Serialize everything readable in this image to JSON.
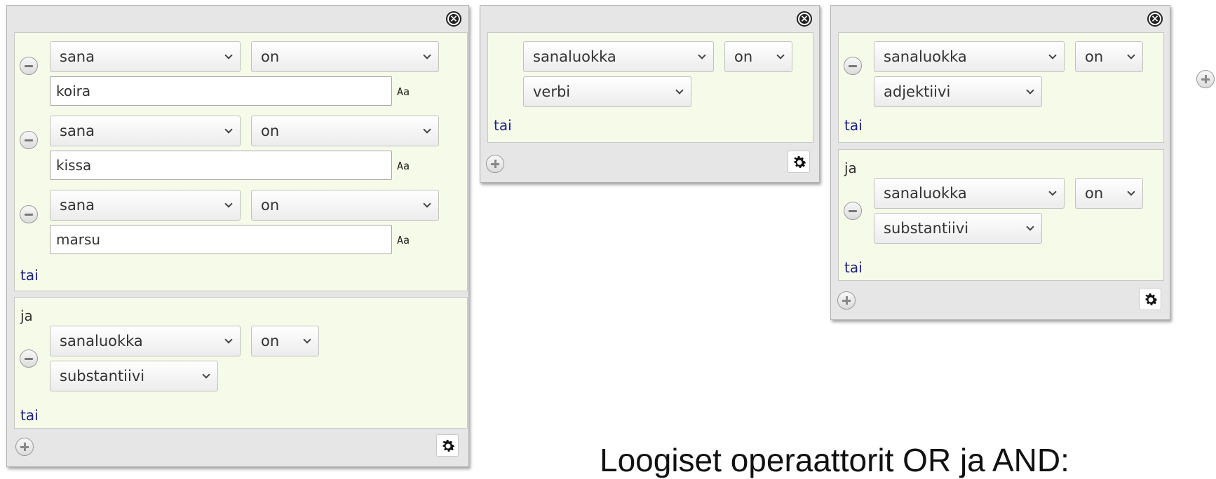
{
  "tokens": [
    {
      "blocks": [
        {
          "rows": [
            {
              "field": "sana",
              "operator": "on",
              "value": "koira",
              "case_toggle": "Aa"
            },
            {
              "field": "sana",
              "operator": "on",
              "value": "kissa",
              "case_toggle": "Aa"
            },
            {
              "field": "sana",
              "operator": "on",
              "value": "marsu",
              "case_toggle": "Aa"
            }
          ],
          "or_label": "tai"
        },
        {
          "and_label": "ja",
          "rows": [
            {
              "field": "sanaluokka",
              "operator": "on",
              "value": "substantiivi"
            }
          ],
          "or_label": "tai"
        }
      ]
    },
    {
      "blocks": [
        {
          "rows": [
            {
              "field": "sanaluokka",
              "operator": "on",
              "value": "verbi"
            }
          ],
          "or_label": "tai"
        }
      ]
    },
    {
      "blocks": [
        {
          "rows": [
            {
              "field": "sanaluokka",
              "operator": "on",
              "value": "adjektiivi"
            }
          ],
          "or_label": "tai"
        },
        {
          "and_label": "ja",
          "rows": [
            {
              "field": "sanaluokka",
              "operator": "on",
              "value": "substantiivi"
            }
          ],
          "or_label": "tai"
        }
      ]
    }
  ],
  "caption": "Loogiset operaattorit OR ja AND:",
  "colors": {
    "token_bg": "#e6e6e6",
    "block_bg": "#f6fae8",
    "or_link": "#1a237e"
  },
  "icons": [
    "close-icon",
    "minus-icon",
    "plus-icon",
    "gear-icon",
    "chevron-down-icon"
  ]
}
